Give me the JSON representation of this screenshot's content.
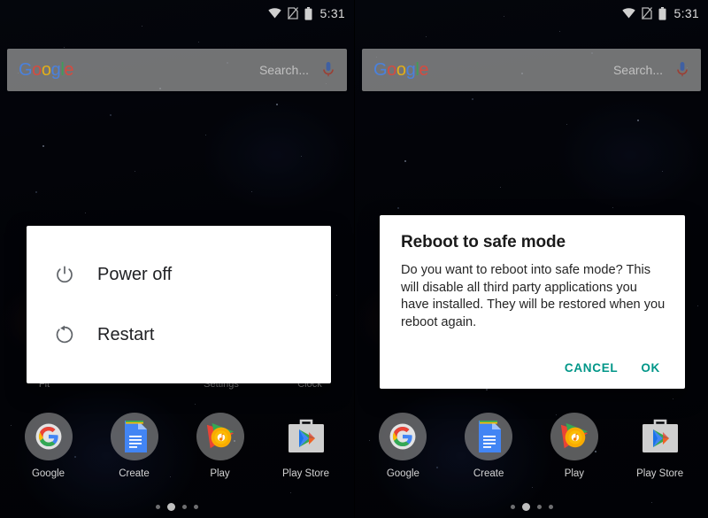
{
  "statusbar": {
    "time": "5:31",
    "icons": [
      "wifi-icon",
      "sim-off-icon",
      "battery-icon"
    ]
  },
  "search": {
    "logo_letters": [
      "G",
      "o",
      "o",
      "g",
      "l",
      "e"
    ],
    "placeholder": "Search...",
    "mic_icon": "microphone-icon"
  },
  "home": {
    "app_row_labels": [
      "Fit",
      "",
      "Settings",
      "Clock"
    ],
    "dock": [
      {
        "label": "Google",
        "icon": "google-g-icon"
      },
      {
        "label": "Create",
        "icon": "google-docs-icon"
      },
      {
        "label": "Play",
        "icon": "play-music-icon"
      },
      {
        "label": "Play Store",
        "icon": "play-store-icon"
      }
    ],
    "page_count": 4,
    "active_page": 2
  },
  "power_dialog": {
    "items": [
      {
        "label": "Power off",
        "icon": "power-icon"
      },
      {
        "label": "Restart",
        "icon": "restart-icon"
      }
    ]
  },
  "safe_mode_dialog": {
    "title": "Reboot to safe mode",
    "message": "Do you want to reboot into safe mode? This will disable all third party applications you have installed. They will be restored when you reboot again.",
    "cancel_label": "CANCEL",
    "ok_label": "OK",
    "accent_color": "#009688"
  }
}
